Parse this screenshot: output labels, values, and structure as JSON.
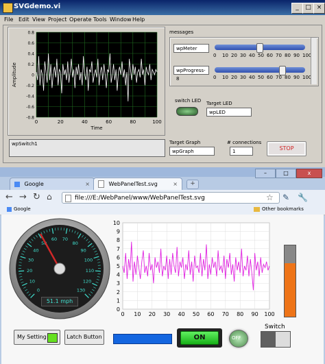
{
  "labview": {
    "title": "SVGdemo.vi",
    "menu": [
      "File",
      "Edit",
      "View",
      "Project",
      "Operate",
      "Tools",
      "Window",
      "Help"
    ],
    "graph": {
      "ylabel": "Amplitude",
      "xlabel": "Time",
      "yticks": [
        "0.8",
        "0.6",
        "0.4",
        "0.2",
        "0",
        "-0.2",
        "-0.4",
        "-0.6",
        "-0.8"
      ],
      "xticks": [
        "0",
        "20",
        "40",
        "60",
        "80",
        "100"
      ],
      "ylim": [
        -0.8,
        0.8
      ],
      "xlim": [
        0,
        100
      ]
    },
    "messages_label": "messages",
    "meter_field": "wpMeter",
    "progress_field": "wpProgress-8",
    "slider_scale": [
      "0",
      "10",
      "20",
      "30",
      "40",
      "50",
      "60",
      "70",
      "80",
      "90",
      "100"
    ],
    "meter_slider_value": 55,
    "progress_slider_value": 77,
    "switch_led_label": "switch LED",
    "target_led_label": "Target LED",
    "target_led_field": "wpLED",
    "switch_field": "wpSwitch1",
    "target_graph_label": "Target Graph",
    "target_graph_field": "wpGraph",
    "connections_label": "# connections",
    "connections_value": "1",
    "stop_label": "STOP"
  },
  "browser": {
    "tabs": [
      "Google",
      "WebPanelTest.svg"
    ],
    "url_text": "file:///E:/WebPanel/www/WebPanelTest.svg",
    "bookmark_google": "Google",
    "other_bookmarks": "Other bookmarks"
  },
  "webpanel": {
    "speed_readout": "51.1 mph",
    "gauge_value": 51.1,
    "gauge_ticks": [
      "0",
      "10",
      "20",
      "30",
      "40",
      "50",
      "60",
      "70",
      "80",
      "90",
      "100",
      "110",
      "120",
      "130"
    ],
    "chart_yticks": [
      "10",
      "9",
      "8",
      "7",
      "6",
      "5",
      "4",
      "3",
      "2",
      "1",
      "0"
    ],
    "chart_xticks": [
      "0",
      "10",
      "20",
      "30",
      "40",
      "50",
      "60",
      "70",
      "80",
      "90",
      "100"
    ],
    "chart_ylim": [
      0,
      10
    ],
    "chart_xlim": [
      0,
      100
    ],
    "tank_level_percent": 75,
    "my_setting_label": "My Setting",
    "latch_button_label": "Latch Button",
    "on_button_label": "ON",
    "off_led_label": "OFF",
    "switch_label": "Switch"
  },
  "chart_data": [
    {
      "type": "line",
      "ylabel": "Amplitude",
      "xlabel": "Time",
      "x_range": [
        0,
        100
      ],
      "ylim": [
        -0.8,
        0.8
      ],
      "series": [
        {
          "values": [
            0.05,
            -0.1,
            0.35,
            -0.2,
            0.1,
            0.0,
            -0.3,
            0.25,
            0.05,
            -0.15,
            0.4,
            -0.1,
            0.2,
            -0.25,
            0.0,
            0.15,
            -0.05,
            0.3,
            -0.2,
            0.1,
            0.05,
            -0.35,
            0.2,
            0.0,
            0.1,
            -0.1,
            0.25,
            -0.15,
            0.05,
            0.3,
            -0.05,
            0.1,
            -0.25,
            0.15,
            0.0,
            0.2,
            -0.1,
            0.05,
            -0.2,
            0.35,
            0.0,
            -0.1,
            0.15,
            -0.3,
            0.1,
            0.05,
            0.25,
            -0.15,
            0.0,
            0.1,
            -0.05,
            0.3,
            -0.2,
            0.05,
            0.15,
            -0.1,
            0.2,
            0.0,
            -0.25,
            0.1,
            0.05,
            0.4,
            -0.15,
            0.0,
            0.2,
            -0.1,
            0.1,
            -0.3,
            0.05,
            0.15,
            0.0,
            0.25,
            -0.05,
            0.1,
            -0.2,
            0.05,
            -0.5,
            0.3,
            0.1,
            -0.1,
            0.2,
            0.0,
            0.15,
            -0.15,
            0.05,
            0.1,
            -0.05,
            0.3,
            0.0,
            0.1,
            -0.2,
            0.15,
            0.05,
            0.0,
            0.2,
            -0.1,
            0.1,
            0.05,
            0.0,
            0.1,
            0.05
          ]
        }
      ]
    },
    {
      "type": "line",
      "x_range": [
        0,
        100
      ],
      "ylim": [
        0,
        10
      ],
      "series": [
        {
          "values": [
            5.0,
            4.2,
            6.5,
            3.5,
            5.8,
            4.5,
            7.8,
            3.2,
            5.5,
            4.0,
            6.2,
            4.8,
            3.5,
            5.5,
            6.8,
            4.2,
            5.0,
            3.8,
            6.5,
            4.5,
            5.2,
            3.0,
            6.0,
            4.8,
            5.5,
            4.2,
            7.0,
            3.8,
            5.0,
            4.5,
            6.2,
            3.5,
            5.8,
            4.0,
            6.5,
            5.0,
            4.2,
            7.2,
            3.8,
            5.5,
            4.8,
            6.0,
            3.5,
            5.2,
            4.5,
            6.8,
            4.0,
            5.5,
            3.2,
            6.2,
            4.8,
            5.0,
            4.2,
            6.5,
            3.8,
            5.8,
            4.5,
            7.5,
            3.5,
            5.2,
            4.0,
            6.0,
            4.8,
            5.5,
            3.8,
            6.8,
            4.5,
            5.0,
            4.2,
            6.2,
            3.5,
            5.8,
            4.8,
            6.5,
            4.0,
            5.2,
            3.2,
            6.0,
            4.5,
            5.5,
            4.2,
            7.0,
            3.8,
            5.0,
            4.5,
            6.2,
            3.8,
            5.8,
            4.2,
            2.2,
            6.5,
            4.5,
            5.5,
            3.8,
            6.0,
            4.2,
            5.2,
            4.8,
            5.5,
            4.5,
            5.0
          ]
        }
      ]
    }
  ]
}
